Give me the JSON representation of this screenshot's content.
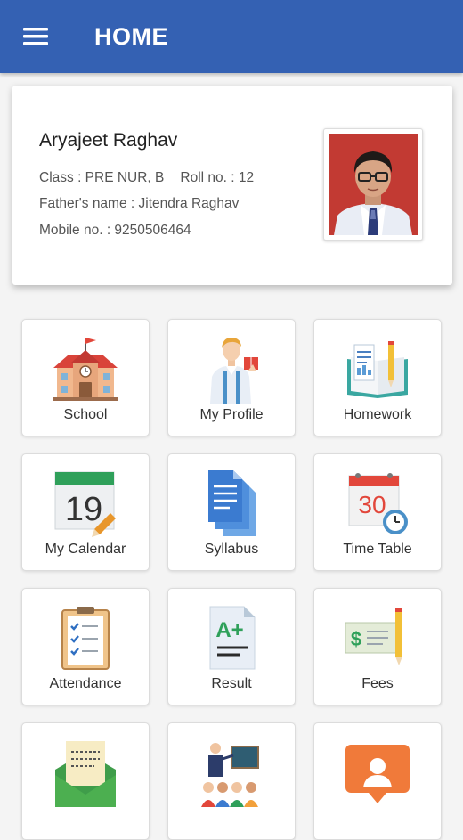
{
  "header": {
    "title": "HOME",
    "menu_icon": "hamburger-menu-icon",
    "bg": "#3461b3"
  },
  "student": {
    "name": "Aryajeet Raghav",
    "class_text": "Class : PRE NUR, B",
    "roll_text": "Roll no. : 12",
    "father_text": "Father's name : Jitendra Raghav",
    "mobile_text": "Mobile no. : 9250506464"
  },
  "tiles": [
    {
      "label": "School",
      "icon": "school-building-icon"
    },
    {
      "label": "My Profile",
      "icon": "teacher-profile-icon"
    },
    {
      "label": "Homework",
      "icon": "homework-book-icon"
    },
    {
      "label": "My Calendar",
      "icon": "calendar-icon",
      "icon_text": "19"
    },
    {
      "label": "Syllabus",
      "icon": "documents-icon"
    },
    {
      "label": "Time Table",
      "icon": "timetable-clock-icon",
      "icon_text": "30"
    },
    {
      "label": "Attendance",
      "icon": "attendance-clipboard-icon"
    },
    {
      "label": "Result",
      "icon": "result-a-plus-icon",
      "icon_text": "A+"
    },
    {
      "label": "Fees",
      "icon": "fees-dollar-icon",
      "icon_text": "$"
    },
    {
      "label": "",
      "icon": "message-envelope-icon"
    },
    {
      "label": "",
      "icon": "teacher-class-icon"
    },
    {
      "label": "",
      "icon": "notification-chat-icon"
    }
  ]
}
